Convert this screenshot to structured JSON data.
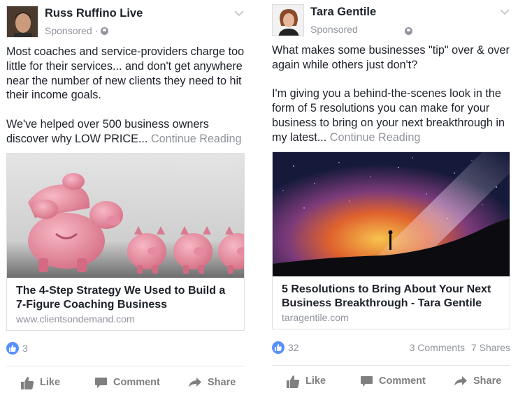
{
  "posts": [
    {
      "author": "Russ Ruffino Live",
      "sponsored": "Sponsored ·",
      "text_paragraphs": [
        "Most coaches and service-providers charge too little for their services... and don't get anywhere near the number of new clients they need to hit their income goals.",
        "We've helped over 500 business owners discover why LOW PRICE..."
      ],
      "continue": "Continue Reading",
      "card": {
        "title": "The 4-Step Strategy We Used to Build a 7-Figure Coaching Business",
        "domain": "www.clientsondemand.com"
      },
      "reactions": "3",
      "comments": "",
      "shares": ""
    },
    {
      "author": "Tara Gentile",
      "sponsored": "Sponsored",
      "text_paragraphs": [
        "What makes some businesses \"tip\" over & over again while others just don't?",
        "I'm giving you a behind-the-scenes look in the form of 5 resolutions you can make for your business to bring on your next breakthrough in my latest..."
      ],
      "continue": "Continue Reading",
      "card": {
        "title": "5 Resolutions to Bring About Your Next Business Breakthrough - Tara Gentile",
        "domain": "taragentile.com"
      },
      "reactions": "32",
      "comments": "3 Comments",
      "shares": "7 Shares"
    }
  ],
  "actions": {
    "like": "Like",
    "comment": "Comment",
    "share": "Share"
  },
  "colors": {
    "link_blue": "#5890ff",
    "muted_gray": "#90949c",
    "text_dark": "#1d2129"
  },
  "icons": [
    "globe-icon",
    "chevron-down-icon",
    "like-reaction-icon",
    "thumbs-up-icon",
    "comment-icon",
    "share-icon"
  ]
}
